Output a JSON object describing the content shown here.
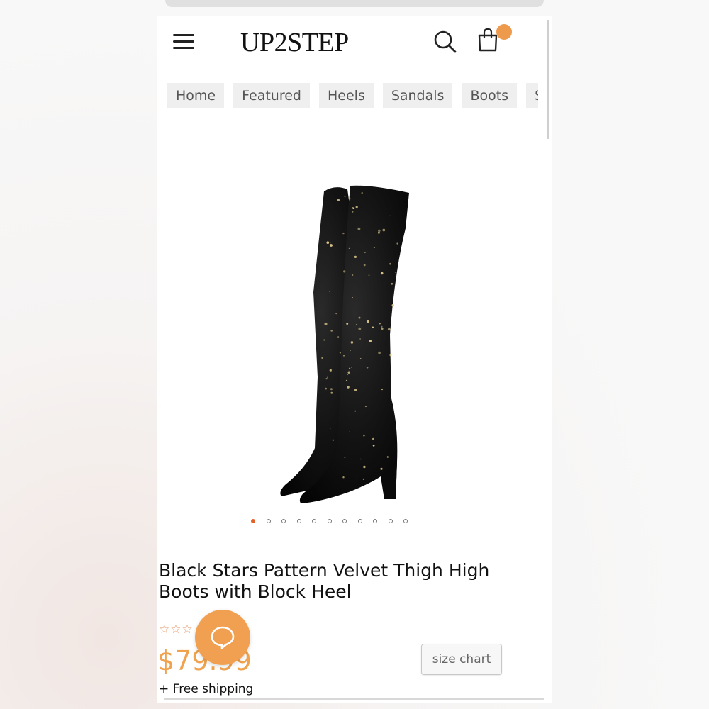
{
  "header": {
    "logo": "UP2STEP",
    "menu_icon": "hamburger-menu-icon",
    "search_icon": "search-icon",
    "cart_icon": "shopping-bag-icon",
    "cart_badge_color": "#ee9a4d"
  },
  "nav": {
    "items": [
      {
        "label": "Home"
      },
      {
        "label": "Featured"
      },
      {
        "label": "Heels"
      },
      {
        "label": "Sandals"
      },
      {
        "label": "Boots"
      },
      {
        "label": "Su"
      }
    ]
  },
  "gallery": {
    "image_count": 11,
    "active_index": 0,
    "active_color": "#e2622c"
  },
  "product": {
    "title": "Black Stars Pattern Velvet Thigh High Boots with Block Heel",
    "rating_stars": "☆☆☆",
    "price": "$79.99",
    "price_color": "#f0a24e",
    "shipping": "+ Free shipping",
    "size_chart_label": "size chart"
  },
  "chat": {
    "icon": "chat-bubble-icon",
    "color": "#f0a050"
  }
}
